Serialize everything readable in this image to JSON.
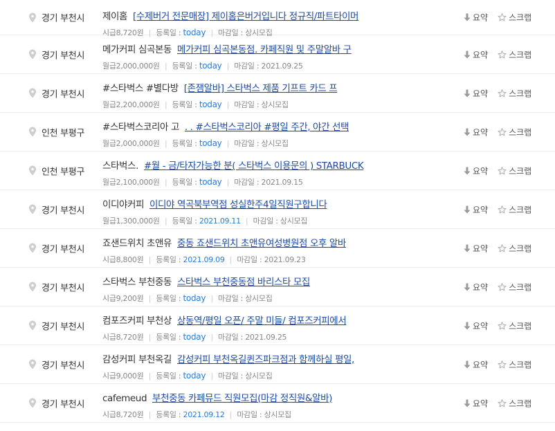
{
  "labels": {
    "summary": "요약",
    "scrap": "스크랩",
    "registered": "등록일",
    "deadline": "마감일",
    "sep": "|"
  },
  "jobs": [
    {
      "location": "경기 부천시",
      "company": "제이홈",
      "title": "[수제버거 전문매장] 제이홈은버거입니다 정규직/파트타이머",
      "pay": "시급8,720원",
      "registered": "today",
      "deadline": "상시모집"
    },
    {
      "location": "경기 부천시",
      "company": "메가커피 심곡본동",
      "title": "메가커피 심곡본동점. 카페직원 및 주말알바 구",
      "pay": "월급2,000,000원",
      "registered": "today",
      "deadline": "2021.09.25"
    },
    {
      "location": "경기 부천시",
      "company": "#스타벅스 #별다방",
      "title": "[존잼알바] 스타벅스 제품 기프트 카드 프",
      "pay": "월급2,200,000원",
      "registered": "today",
      "deadline": "상시모집"
    },
    {
      "location": "인천 부평구",
      "company": "#스타벅스코리아 고",
      "title": ". . #스타벅스코리아 #평일 주간, 야간 선택",
      "pay": "월급2,000,000원",
      "registered": "today",
      "deadline": "상시모집"
    },
    {
      "location": "인천 부평구",
      "company": "스타벅스.",
      "title": "#월 - 금/타자가능한 분( 스타벅스 이용문의 ) STARBUCK",
      "pay": "월급2,100,000원",
      "registered": "today",
      "deadline": "2021.09.15"
    },
    {
      "location": "경기 부천시",
      "company": "이디야커피",
      "title": "이디야 역곡북부역점 성실한주4일직원구합니다",
      "pay": "월급1,300,000원",
      "registered": "2021.09.11",
      "deadline": "상시모집"
    },
    {
      "location": "경기 부천시",
      "company": "죠샌드위치 초앤유",
      "title": "중동 죠샌드위치 초앤유여성병원점 오후 알바",
      "pay": "시급8,800원",
      "registered": "2021.09.09",
      "deadline": "2021.09.23"
    },
    {
      "location": "경기 부천시",
      "company": "스타벅스 부천중동",
      "title": "스타벅스 부천중동점 바리스타 모집",
      "pay": "시급9,200원",
      "registered": "today",
      "deadline": "상시모집"
    },
    {
      "location": "경기 부천시",
      "company": "컴포즈커피 부천상",
      "title": "상동역/평일 오픈/ 주말 미들/ 컴포즈커피에서",
      "pay": "시급8,720원",
      "registered": "today",
      "deadline": "2021.09.25"
    },
    {
      "location": "경기 부천시",
      "company": "감성커피 부천옥길",
      "title": "감성커피 부천옥길퀸즈파크점과 함께하실 평일,",
      "pay": "시급9,000원",
      "registered": "today",
      "deadline": "상시모집"
    },
    {
      "location": "경기 부천시",
      "company": "cafemeud",
      "title": "부천중동 카페뮤드 직원모집(마감 정직원&알바)",
      "pay": "시급8,720원",
      "registered": "2021.09.12",
      "deadline": "상시모집"
    }
  ]
}
